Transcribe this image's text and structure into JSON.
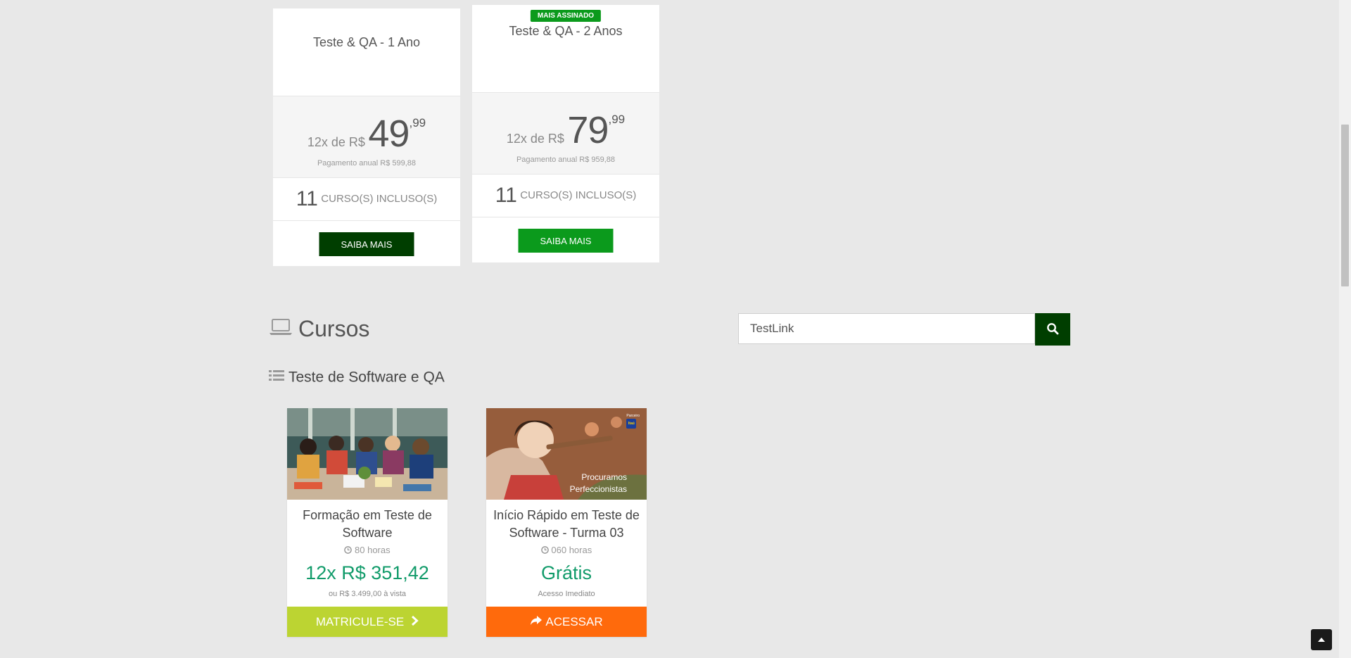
{
  "plans": [
    {
      "badge": "",
      "title": "Teste & QA - 1 Ano",
      "price_prefix": "12x de R$",
      "price_int": "49",
      "price_cents": ",99",
      "annual_note": "Pagamento anual R$ 599,88",
      "courses_count": "11",
      "courses_label": "CURSO(S) INCLUSO(S)",
      "cta_label": "SAIBA MAIS",
      "cta_color": "#003e00"
    },
    {
      "badge": "MAIS ASSINADO",
      "title": "Teste & QA - 2 Anos",
      "price_prefix": "12x de R$",
      "price_int": "79",
      "price_cents": ",99",
      "annual_note": "Pagamento anual R$ 959,88",
      "courses_count": "11",
      "courses_label": "CURSO(S) INCLUSO(S)",
      "cta_label": "SAIBA MAIS",
      "cta_color": "#0b9a1c"
    }
  ],
  "courses_section": {
    "title": "Cursos",
    "icon": "laptop-icon"
  },
  "search": {
    "value": "TestLink",
    "button_icon": "search-icon"
  },
  "category": {
    "title": "Teste de Software e QA",
    "icon": "list-icon"
  },
  "cards": [
    {
      "title": "Formação em Teste de Software",
      "hours": "80 horas",
      "price": "12x R$ 351,42",
      "note": "ou R$ 3.499,00 à vista",
      "button_label": "MATRICULE-SE",
      "button_icon": "chevron-right-icon",
      "button_color": "#bcd432"
    },
    {
      "title": "Início Rápido em Teste de Software - Turma 03",
      "hours": "060 horas",
      "price": "Grátis",
      "note": "Acesso Imediato",
      "button_label": "ACESSAR",
      "button_icon": "share-arrow-icon",
      "button_color": "#ff6a0c",
      "image_caption_line1": "Procuramos",
      "image_caption_line2": "Perfeccionistas",
      "image_tag_top": "Parceiro",
      "image_tag_logo": "Itaú"
    }
  ],
  "colors": {
    "background": "#e8e8e8",
    "price_green": "#119b6a",
    "dark_green": "#003e00"
  }
}
